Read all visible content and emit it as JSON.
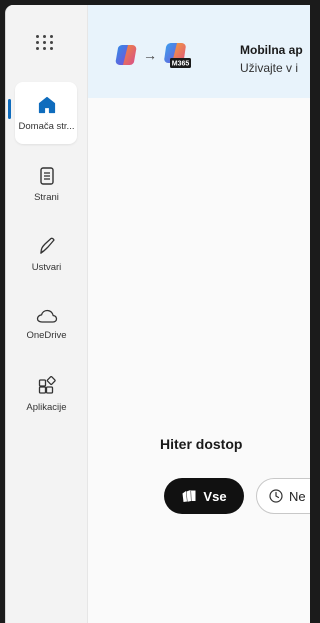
{
  "nav": {
    "items": [
      {
        "label": "Domača str...",
        "icon": "home-icon",
        "active": true
      },
      {
        "label": "Strani",
        "icon": "pages-icon",
        "active": false
      },
      {
        "label": "Ustvari",
        "icon": "create-pen-icon",
        "active": false
      },
      {
        "label": "OneDrive",
        "icon": "cloud-icon",
        "active": false
      },
      {
        "label": "Aplikacije",
        "icon": "apps-icon",
        "active": false
      }
    ]
  },
  "banner": {
    "title": "Mobilna ap",
    "subtitle": "Uživajte v i",
    "badge": "M365",
    "arrow": "→"
  },
  "quick_access": {
    "title": "Hiter dostop",
    "filters": [
      {
        "label": "Vse",
        "selected": true
      },
      {
        "label": "Ne",
        "selected": false
      }
    ]
  },
  "colors": {
    "accent": "#0f6cbd",
    "banner_bg": "#e8f3fb",
    "selected_chip": "#111111"
  }
}
